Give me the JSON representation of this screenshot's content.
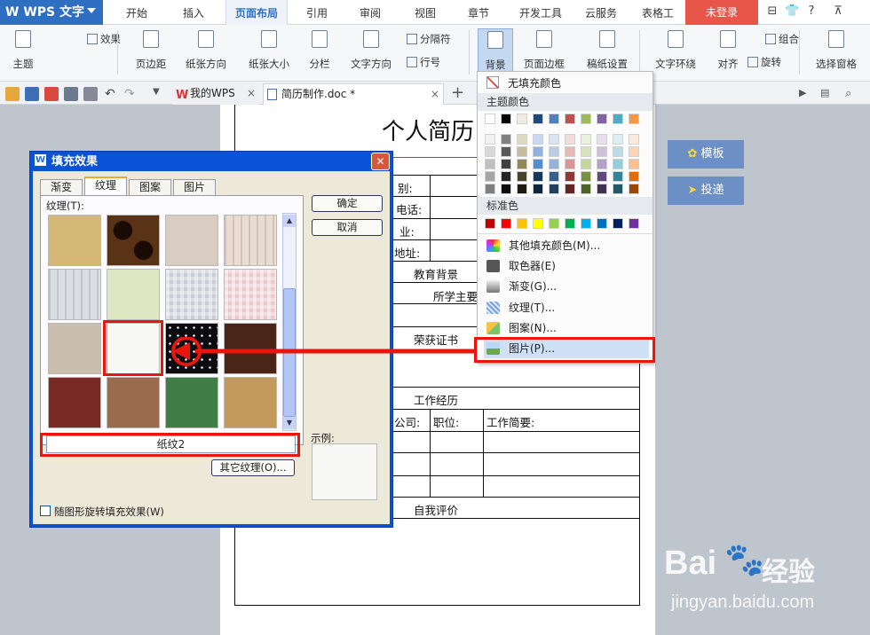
{
  "app": {
    "logo": "W WPS 文字",
    "login": "未登录",
    "window_icons": [
      "⊟",
      "👕",
      "?",
      "⊼"
    ]
  },
  "menu_tabs": [
    "开始",
    "插入",
    "页面布局",
    "引用",
    "审阅",
    "视图",
    "章节",
    "开发工具",
    "云服务",
    "表格工"
  ],
  "active_tab": "页面布局",
  "ribbon": {
    "buttons": [
      {
        "label": "主题",
        "icon": "theme-icon"
      },
      {
        "label": "效果",
        "icon": "effect-icon"
      },
      {
        "label": "页边距",
        "icon": "margin-icon"
      },
      {
        "label": "纸张方向",
        "icon": "orientation-icon"
      },
      {
        "label": "纸张大小",
        "icon": "paper-size-icon"
      },
      {
        "label": "分栏",
        "icon": "columns-icon"
      },
      {
        "label": "文字方向",
        "icon": "text-direction-icon"
      },
      {
        "label": "分隔符",
        "icon": "separator-icon"
      },
      {
        "label": "行号",
        "icon": "line-number-icon"
      },
      {
        "label": "背景",
        "icon": "background-icon"
      },
      {
        "label": "页面边框",
        "icon": "page-border-icon"
      },
      {
        "label": "稿纸设置",
        "icon": "draft-paper-icon"
      },
      {
        "label": "文字环绕",
        "icon": "wrap-icon"
      },
      {
        "label": "对齐",
        "icon": "align-icon"
      },
      {
        "label": "组合",
        "icon": "group-icon"
      },
      {
        "label": "旋转",
        "icon": "rotate-icon"
      },
      {
        "label": "选择窗格",
        "icon": "select-pane-icon"
      }
    ]
  },
  "doc_tabs": [
    {
      "label": "我的WPS",
      "icon": "wps-icon"
    },
    {
      "label": "简历制作.doc *",
      "icon": "doc-icon"
    }
  ],
  "document": {
    "title": "个人简历",
    "labels": {
      "gender": "别:",
      "phone": "电话:",
      "major": "业:",
      "address": "地址:",
      "education": "教育背景",
      "major_course": "所学主要",
      "awards": "荣获证书",
      "work": "工作经历",
      "company": "公司:",
      "position": "职位:",
      "work_brief": "工作简要:",
      "self_eval": "自我评价"
    }
  },
  "side_buttons": {
    "template": "模板",
    "submit": "投递"
  },
  "dialog": {
    "title": "填充效果",
    "tabs": [
      "渐变",
      "纹理",
      "图案",
      "图片"
    ],
    "active_tab": "纹理",
    "texture_label": "纹理(T):",
    "selected_name": "纸纹2",
    "other_texture": "其它纹理(O)...",
    "ok": "确定",
    "cancel": "取消",
    "preview_label": "示例:",
    "rotate_checkbox": "随图形旋转填充效果(W)",
    "textures": [
      {
        "name": "sand",
        "color": "#d6b876"
      },
      {
        "name": "leopard",
        "color": "#5a3215"
      },
      {
        "name": "stone-text",
        "color": "#d9cdc3"
      },
      {
        "name": "wood-light",
        "color": "#eadcd0"
      },
      {
        "name": "stripe-gray",
        "color": "#dcdde2"
      },
      {
        "name": "cloth-green",
        "color": "#dfe6c2"
      },
      {
        "name": "weave-gray",
        "color": "#c9cdd6"
      },
      {
        "name": "pink-check",
        "color": "#ecc8cc"
      },
      {
        "name": "canvas",
        "color": "#cabfae"
      },
      {
        "name": "paper-white",
        "color": "#f7f7f5"
      },
      {
        "name": "starry",
        "color": "#0b0b10"
      },
      {
        "name": "brown-floral",
        "color": "#4a2416"
      },
      {
        "name": "red-floral",
        "color": "#7a2a25"
      },
      {
        "name": "brown-wood",
        "color": "#9c6a4c"
      },
      {
        "name": "green-fabric",
        "color": "#3f7f45"
      },
      {
        "name": "burlap",
        "color": "#c39a5c"
      }
    ]
  },
  "bg_menu": {
    "no_fill": "无填充颜色",
    "theme_colors": "主题颜色",
    "standard_colors": "标准色",
    "theme_top": [
      "#ffffff",
      "#000000",
      "#eeece1",
      "#1f497d",
      "#4f81bd",
      "#c0504d",
      "#9bbb59",
      "#8064a2",
      "#4bacc6",
      "#f79646"
    ],
    "theme_shades": [
      [
        "#f2f2f2",
        "#7f7f7f",
        "#ddd9c3",
        "#c6d9f0",
        "#dbe5f1",
        "#f2dcdb",
        "#ebf1dd",
        "#e5e0ec",
        "#dbeef3",
        "#fdeada"
      ],
      [
        "#d8d8d8",
        "#595959",
        "#c4bd97",
        "#8db3e2",
        "#b8cce4",
        "#e5b9b7",
        "#d7e3bc",
        "#ccc1d9",
        "#b7dde8",
        "#fbd5b5"
      ],
      [
        "#bfbfbf",
        "#3f3f3f",
        "#938953",
        "#548dd4",
        "#95b3d7",
        "#d99694",
        "#c3d69b",
        "#b2a2c7",
        "#92cddc",
        "#fac08f"
      ],
      [
        "#a5a5a5",
        "#262626",
        "#494429",
        "#17365d",
        "#366092",
        "#953734",
        "#76923c",
        "#5f497a",
        "#31859b",
        "#e36c09"
      ],
      [
        "#7f7f7f",
        "#0c0c0c",
        "#1d1b10",
        "#0f243e",
        "#244061",
        "#632423",
        "#4f6128",
        "#3f3151",
        "#205867",
        "#974806"
      ]
    ],
    "standard": [
      "#c00000",
      "#ff0000",
      "#ffc000",
      "#ffff00",
      "#92d050",
      "#00b050",
      "#00b0f0",
      "#0070c0",
      "#002060",
      "#7030a0"
    ],
    "items": [
      {
        "label": "其他填充颜色(M)...",
        "icon": "palette-icon"
      },
      {
        "label": "取色器(E)",
        "icon": "eyedropper-icon"
      },
      {
        "label": "渐变(G)...",
        "icon": "gradient-icon"
      },
      {
        "label": "纹理(T)...",
        "icon": "texture-icon"
      },
      {
        "label": "图案(N)...",
        "icon": "pattern-icon"
      },
      {
        "label": "图片(P)...",
        "icon": "picture-icon"
      }
    ]
  },
  "watermark": {
    "brand": "Bai",
    "brand2": "经验",
    "url": "jingyan.baidu.com"
  }
}
